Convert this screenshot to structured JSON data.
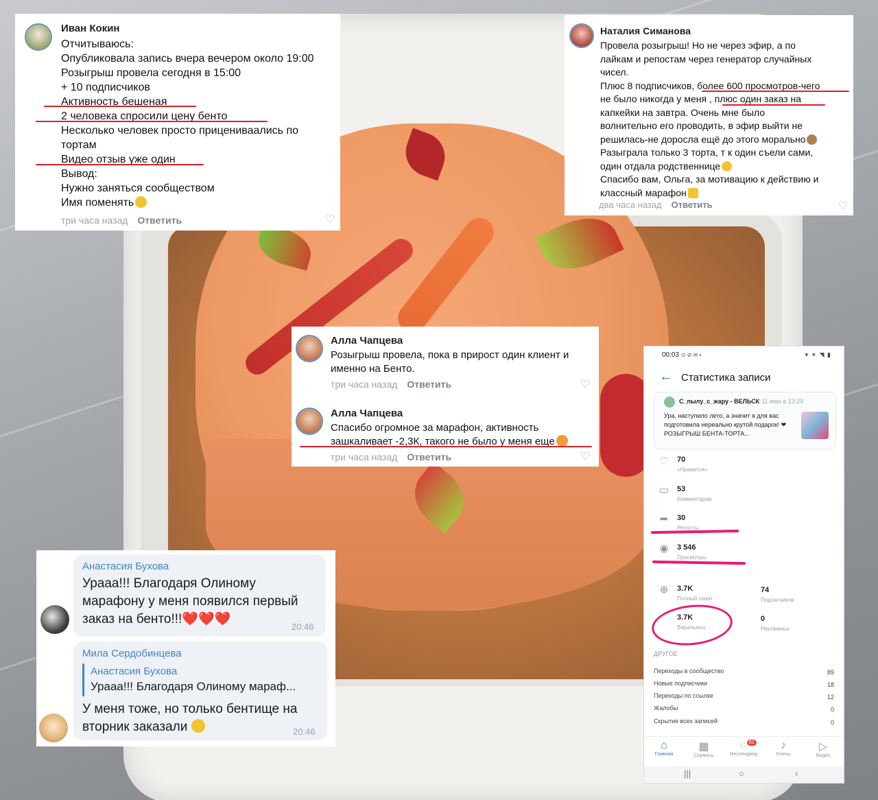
{
  "card1": {
    "name": "Иван Кокин",
    "lines": [
      "Отчитываюсь:",
      "Опубликовала запись вчера вечером около 19:00",
      "Розыгрыш провела сегодня в 15:00",
      "+ 10 подписчиков",
      "Активность бешеная",
      "2 человека спросили цену бенто",
      "Несколько человек просто прицениваались по",
      "тортам",
      "Видео отзыв уже один",
      "Вывод:",
      "Нужно заняться сообществом",
      "Имя поменять"
    ],
    "time": "три часа назад",
    "reply": "Ответить"
  },
  "card2": {
    "name": "Наталия Симанова",
    "lines": [
      "Провела розыгрыш! Но не через эфир, а по",
      "лайкам и репостам через генератор случайных",
      "чисел.",
      "Плюс 8 подписчиков, более 600 просмотров-чего",
      "не было никогда у меня , плюс один заказ на",
      "капкейки  на завтра. Очень мне было",
      "волнительно его проводить, в эфир выйти не",
      "решилась-не доросла ещё до этого морально",
      "Разыграла только 3 торта, т к один съели сами,",
      "один отдала родственнице",
      "Спасибо вам, Ольга, за мотивацию к действию и",
      "классный марафон"
    ],
    "time": "два часа назад",
    "reply": "Ответить"
  },
  "card3": {
    "comments": [
      {
        "name": "Алла Чапцева",
        "lines": [
          "Розыгрыш провела, пока в прирост один клиент и",
          "именно на Бенто."
        ],
        "time": "три часа назад",
        "reply": "Ответить"
      },
      {
        "name": "Алла Чапцева",
        "lines": [
          "Спасибо огромное за марафон, активность",
          "зашкаливает -2,3К, такого не было у меня еще"
        ],
        "time": "три часа назад",
        "reply": "Ответить"
      }
    ]
  },
  "telegram": {
    "msg1": {
      "name": "Анастасия Бухова",
      "lines": [
        "Урааа!!! Благодаря Олиному",
        "марафону у меня появился первый",
        "заказ на бенто!!!"
      ],
      "hearts": "❤️❤️❤️",
      "time": "20:46"
    },
    "msg2": {
      "name": "Мила Сердобинцева",
      "quote_name": "Анастасия Бухова",
      "quote_text": "Урааа!!! Благодаря Олиному мараф...",
      "lines": [
        "У меня тоже, но только бентище на",
        "вторник заказали"
      ],
      "time": "20:46"
    }
  },
  "phone": {
    "status_time": "00:03",
    "status_icons": "⊙ ⊘ ✉ •",
    "status_right": "▾ ✶ ◥ ▮",
    "title": "Статистика записи",
    "post": {
      "author": "С_пылу_с_жару - ВЕЛЬСК",
      "date": "11 июн в 13:29",
      "text": "Ура, наступило лето, а значит я для вас подготовила нереально крутой подарок! ❤РОЗЫГРЫШ БЕНТА-ТОРТА..."
    },
    "stats": [
      {
        "icon": "heart-icon",
        "value": "70",
        "label": "«Нравится»"
      },
      {
        "icon": "comment-icon",
        "value": "53",
        "label": "Комментарии"
      },
      {
        "icon": "share-icon",
        "value": "30",
        "label": "Репосты"
      },
      {
        "icon": "eye-icon",
        "value": "3 546",
        "label": "Просмотры"
      }
    ],
    "reach": {
      "value": "3.7K",
      "label": "Полный охват"
    },
    "subs": {
      "value": "74",
      "label": "Подписчиков"
    },
    "viral": {
      "value": "3.7K",
      "label": "Виральных"
    },
    "ads": {
      "value": "0",
      "label": "Рекламных"
    },
    "other_title": "ДРУГОЕ",
    "other": [
      {
        "label": "Переходы в сообщество",
        "value": "89"
      },
      {
        "label": "Новые подписчики",
        "value": "18"
      },
      {
        "label": "Переходы по ссылке",
        "value": "12"
      },
      {
        "label": "Жалобы",
        "value": "0"
      },
      {
        "label": "Скрытия всех записей",
        "value": "0"
      }
    ],
    "tabs": [
      {
        "icon": "home-icon",
        "label": "Главная"
      },
      {
        "icon": "services-icon",
        "label": "Сервисы"
      },
      {
        "icon": "messenger-icon",
        "label": "Мессенджер"
      },
      {
        "icon": "clips-icon",
        "label": "Клипы"
      },
      {
        "icon": "video-icon",
        "label": "Видео"
      }
    ],
    "messenger_badge": "61",
    "accent": "#3a77c2",
    "highlight": "#e61b7a"
  }
}
